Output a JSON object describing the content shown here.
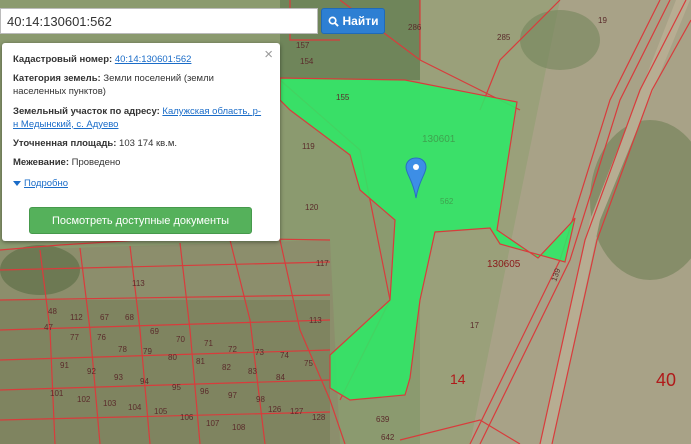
{
  "search": {
    "value": "40:14:130601:562",
    "button_label": "Найти"
  },
  "info_panel": {
    "cadastral_label": "Кадастровый номер:",
    "cadastral_value": "40:14:130601:562",
    "category_label": "Категория земель:",
    "category_value": "Земли поселений (земли населенных пунктов)",
    "address_label": "Земельный участок по адресу:",
    "address_value": "Калужская область, р-н Медынский, с. Адуево",
    "area_label": "Уточненная площадь:",
    "area_value": "103 174 кв.м.",
    "survey_label": "Межевание:",
    "survey_value": "Проведено",
    "details_link": "Подробно",
    "docs_button": "Посмотреть доступные документы"
  },
  "map": {
    "parcel_color": "#2ee866",
    "boundary_color": "#d83c3c",
    "marker_color": "#3d8ee6",
    "parcel_labels": [
      "130601",
      "562",
      "130605",
      "17",
      "14",
      "40",
      "19",
      "285",
      "286",
      "119",
      "120",
      "117",
      "113",
      "113",
      "139",
      "639",
      "642",
      "112",
      "68",
      "69",
      "70",
      "71",
      "72",
      "73",
      "74",
      "75",
      "77",
      "76",
      "78",
      "79",
      "80",
      "81",
      "82",
      "83",
      "84",
      "91",
      "92",
      "93",
      "94",
      "95",
      "96",
      "97",
      "98",
      "101",
      "102",
      "103",
      "104",
      "105",
      "106",
      "107",
      "108",
      "155",
      "154",
      "157",
      "126",
      "127",
      "128",
      "48",
      "47",
      "67"
    ]
  }
}
